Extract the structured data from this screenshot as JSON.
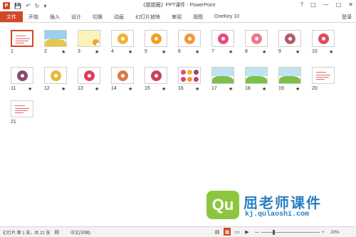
{
  "titlebar": {
    "app_icon_letter": "P",
    "title": "《甜甜圈》PPT课件 - PowerPoint",
    "qa_icons": [
      "save-icon",
      "undo-icon",
      "redo-icon",
      "customize-icon"
    ],
    "controls": [
      "?",
      "□",
      "—",
      "▢",
      "✕"
    ]
  },
  "ribbon": {
    "file": "文件",
    "tabs": [
      "开始",
      "插入",
      "设计",
      "切换",
      "动画",
      "幻灯片放映",
      "审阅",
      "视图",
      "OneKey 10"
    ],
    "login": "登录"
  },
  "slides": [
    {
      "num": "1",
      "star": "",
      "kind": "text-selected"
    },
    {
      "num": "2",
      "star": "★",
      "kind": "cartoon"
    },
    {
      "num": "3",
      "star": "★",
      "kind": "yellow"
    },
    {
      "num": "4",
      "star": "★",
      "kind": "donut",
      "color": "#f2b233"
    },
    {
      "num": "5",
      "star": "★",
      "kind": "donut",
      "color": "#f0a020"
    },
    {
      "num": "6",
      "star": "★",
      "kind": "donut",
      "color": "#f29a3b"
    },
    {
      "num": "7",
      "star": "★",
      "kind": "donut",
      "color": "#e94b7b"
    },
    {
      "num": "8",
      "star": "★",
      "kind": "donut",
      "color": "#f0758f"
    },
    {
      "num": "9",
      "star": "★",
      "kind": "donut",
      "color": "#b55b6a"
    },
    {
      "num": "10",
      "star": "★",
      "kind": "donut",
      "color": "#e04a5f"
    },
    {
      "num": "11",
      "star": "★",
      "kind": "donut",
      "color": "#8a4a6d"
    },
    {
      "num": "12",
      "star": "★",
      "kind": "donut",
      "color": "#e8b83a"
    },
    {
      "num": "13",
      "star": "★",
      "kind": "donut",
      "color": "#e03d5c"
    },
    {
      "num": "14",
      "star": "★",
      "kind": "donut",
      "color": "#d97a4a"
    },
    {
      "num": "15",
      "star": "★",
      "kind": "donut",
      "color": "#c9425e"
    },
    {
      "num": "16",
      "star": "★",
      "kind": "multi"
    },
    {
      "num": "17",
      "star": "★",
      "kind": "scene"
    },
    {
      "num": "18",
      "star": "★",
      "kind": "scene"
    },
    {
      "num": "19",
      "star": "★",
      "kind": "scene"
    },
    {
      "num": "20",
      "star": "",
      "kind": "text"
    },
    {
      "num": "21",
      "star": "",
      "kind": "text"
    }
  ],
  "watermark": {
    "logo_text": "Qu",
    "title": "屈老师课件",
    "url": "kj.qulaoshi.com"
  },
  "statusbar": {
    "slide_info": "幻灯片 第 1 张，共 21 张",
    "lang": "中文(中国)",
    "zoom": "20%",
    "zoom_fraction": 0.2
  },
  "colors": {
    "accent": "#d24726",
    "watermark_green": "#8cc63f",
    "watermark_blue": "#2a7fc1"
  }
}
